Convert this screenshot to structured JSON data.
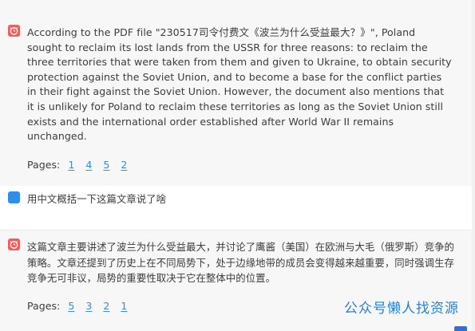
{
  "messages": [
    {
      "role": "assistant",
      "text": "According to the PDF file \"230517司令付费文《波兰为什么受益最大？》\", Poland sought to reclaim its lost lands from the USSR for three reasons: to reclaim the three territories that were taken from them and given to Ukraine, to obtain security protection against the Soviet Union, and to become a base for the conflict parties in their fight against the Soviet Union. However, the document also mentions that it is unlikely for Poland to reclaim these territories as long as the Soviet Union still exists and the international order established after World War II remains unchanged.",
      "pages_label": "Pages:",
      "pages": [
        "1",
        "4",
        "5",
        "2"
      ]
    },
    {
      "role": "user",
      "text": "用中文概括一下这篇文章说了啥"
    },
    {
      "role": "assistant",
      "text": "这篇文章主要讲述了波兰为什么受益最大，并讨论了鹰酱（美国）在欧洲与大毛（俄罗斯）竞争的策略。文章还提到了历史上在不同局势下，处于边缘地带的成员会变得越来越重要，同时强调生存竞争无可非议，局势的重要性取决于它在整体中的位置。",
      "pages_label": "Pages:",
      "pages": [
        "5",
        "3",
        "2",
        "1"
      ]
    }
  ],
  "watermark": "公众号懒人找资源",
  "icons": {
    "assistant_avatar": "robot-alarm-icon",
    "user_avatar": "user-square-icon"
  },
  "colors": {
    "assistant_avatar": "#ef5d5d",
    "user_avatar": "#2f8ee8",
    "link": "#2f8ee8",
    "watermark": "#2a7fd4"
  }
}
